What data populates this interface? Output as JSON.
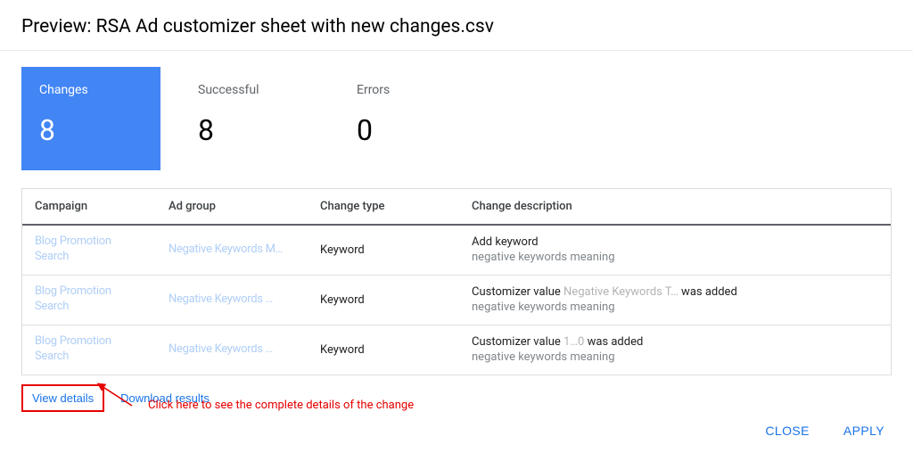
{
  "header": {
    "title": "Preview: RSA Ad customizer sheet with new changes.csv"
  },
  "stats": {
    "changes": {
      "label": "Changes",
      "value": "8"
    },
    "successful": {
      "label": "Successful",
      "value": "8"
    },
    "errors": {
      "label": "Errors",
      "value": "0"
    }
  },
  "table": {
    "headers": {
      "campaign": "Campaign",
      "adgroup": "Ad group",
      "changetype": "Change type",
      "changedesc": "Change description"
    },
    "rows": [
      {
        "campaign": "Blog Promotion Search",
        "adgroup": "Negative Keywords M…",
        "changetype": "Keyword",
        "desc_primary": "Add keyword",
        "desc_secondary": "negative keywords meaning"
      },
      {
        "campaign": "Blog Promotion Search",
        "adgroup": "Negative Keywords …",
        "changetype": "Keyword",
        "desc_primary": "Customizer value Negative Keywords T… was added",
        "desc_secondary": "negative keywords meaning"
      },
      {
        "campaign": "Blog Promotion Search",
        "adgroup": "Negative Keywords …",
        "changetype": "Keyword",
        "desc_primary": "Customizer value 1…0 was added",
        "desc_secondary": "negative keywords meaning"
      }
    ]
  },
  "links": {
    "view_details": "View details",
    "download_results": "Download results"
  },
  "annotation": {
    "text": "Click here to see the complete details of the change"
  },
  "footer": {
    "close": "CLOSE",
    "apply": "APPLY"
  }
}
